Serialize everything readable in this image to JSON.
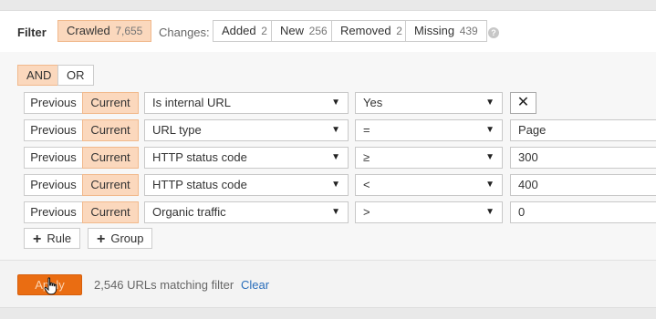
{
  "header": {
    "filter_label": "Filter",
    "crawled": {
      "label": "Crawled",
      "count": "7,655"
    },
    "changes_label": "Changes:",
    "changes": [
      {
        "label": "Added",
        "count": "2"
      },
      {
        "label": "New",
        "count": "256"
      },
      {
        "label": "Removed",
        "count": "2"
      },
      {
        "label": "Missing",
        "count": "439"
      }
    ],
    "help_icon": "?"
  },
  "logic": {
    "and_label": "AND",
    "or_label": "OR",
    "selected": "AND"
  },
  "rules": [
    {
      "previous": "Previous",
      "current": "Current",
      "field": "Is internal URL",
      "operator": "Yes",
      "value": "",
      "remove": "✕"
    },
    {
      "previous": "Previous",
      "current": "Current",
      "field": "URL type",
      "operator": "=",
      "value": "Page"
    },
    {
      "previous": "Previous",
      "current": "Current",
      "field": "HTTP status code",
      "operator": "≥",
      "value": "300"
    },
    {
      "previous": "Previous",
      "current": "Current",
      "field": "HTTP status code",
      "operator": "<",
      "value": "400"
    },
    {
      "previous": "Previous",
      "current": "Current",
      "field": "Organic traffic",
      "operator": ">",
      "value": "0"
    }
  ],
  "actions": {
    "add_rule": "Rule",
    "add_group": "Group"
  },
  "footer": {
    "apply": "Apply",
    "match_text": "2,546 URLs matching filter",
    "clear": "Clear"
  },
  "colors": {
    "accent": "#ea6d12",
    "selected_bg": "#fbd8bd",
    "link": "#2a6ebb"
  }
}
